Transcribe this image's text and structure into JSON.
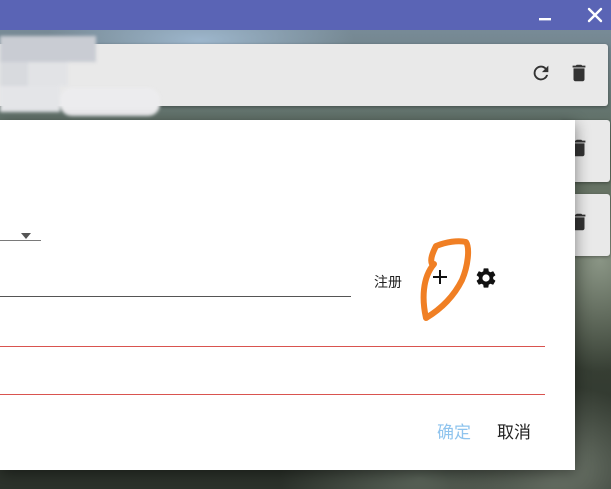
{
  "window": {
    "titlebar_color": "#5a64b5",
    "minimize_icon": "minimize-icon",
    "close_icon": "close-icon"
  },
  "list": {
    "items": [
      {
        "actions": [
          "refresh-icon",
          "trash-icon"
        ]
      },
      {
        "actions": [
          "trash-icon"
        ]
      },
      {
        "actions": [
          "trash-icon"
        ]
      }
    ]
  },
  "dialog": {
    "register_label": "注册",
    "add_icon": "plus-icon",
    "settings_icon": "gear-icon",
    "dropdown_icon": "caret-down-icon",
    "error_color": "#d9534f",
    "confirm_label": "确定",
    "cancel_label": "取消",
    "confirm_color": "#8fc4ee",
    "annotation_color": "#f07f24"
  }
}
